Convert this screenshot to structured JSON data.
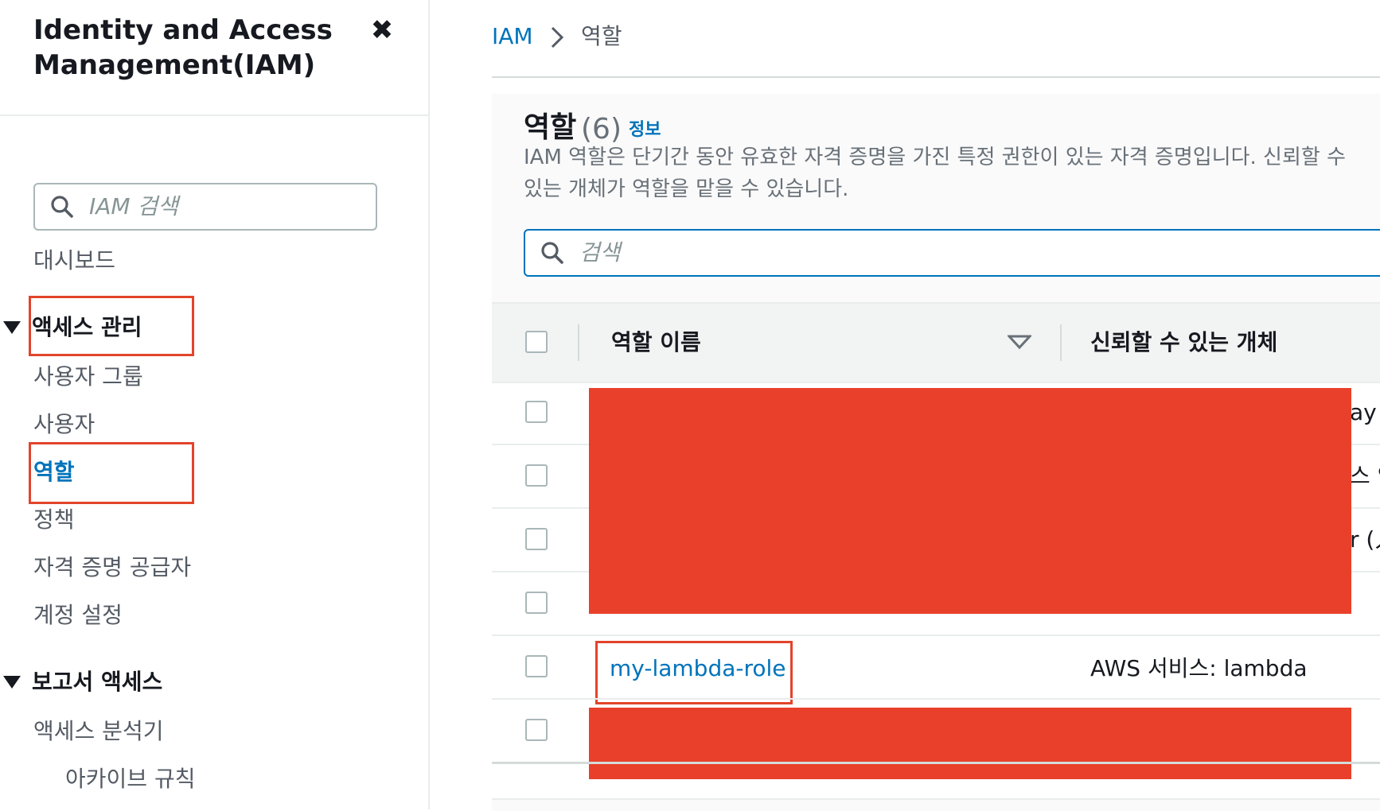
{
  "sidebar": {
    "title": "Identity and Access\nManagement(IAM)",
    "close_label": "✖",
    "search_placeholder": "IAM 검색",
    "dashboard": "대시보드",
    "access_management": "액세스 관리",
    "user_groups": "사용자 그룹",
    "users": "사용자",
    "roles": "역할",
    "policies": "정책",
    "identity_providers": "자격 증명 공급자",
    "account_settings": "계정 설정",
    "access_reports": "보고서 액세스",
    "access_analyzer": "액세스 분석기",
    "archive_rules": "아카이브 규칙"
  },
  "breadcrumb": {
    "root": "IAM",
    "current": "역할"
  },
  "roles_panel": {
    "title": "역할",
    "count": "(6)",
    "info_link": "정보",
    "description": "IAM 역할은 단기간 동안 유효한 자격 증명을 가진 특정 권한이 있는 자격 증명입니다. 신뢰할 수 있는 개체가 역할을 맡을 수 있습니다.",
    "search_placeholder": "검색"
  },
  "table": {
    "columns": [
      "역할 이름",
      "신뢰할 수 있는 개체"
    ],
    "edge_fragments": [
      "ay",
      "스 인",
      "r (人"
    ],
    "visible_row": {
      "role_name": "my-lambda-role",
      "trusted_entity": "AWS 서비스: lambda"
    }
  },
  "colors": {
    "link": "#0073bb",
    "highlight": "#e2442a",
    "redaction": "#e8402a"
  }
}
